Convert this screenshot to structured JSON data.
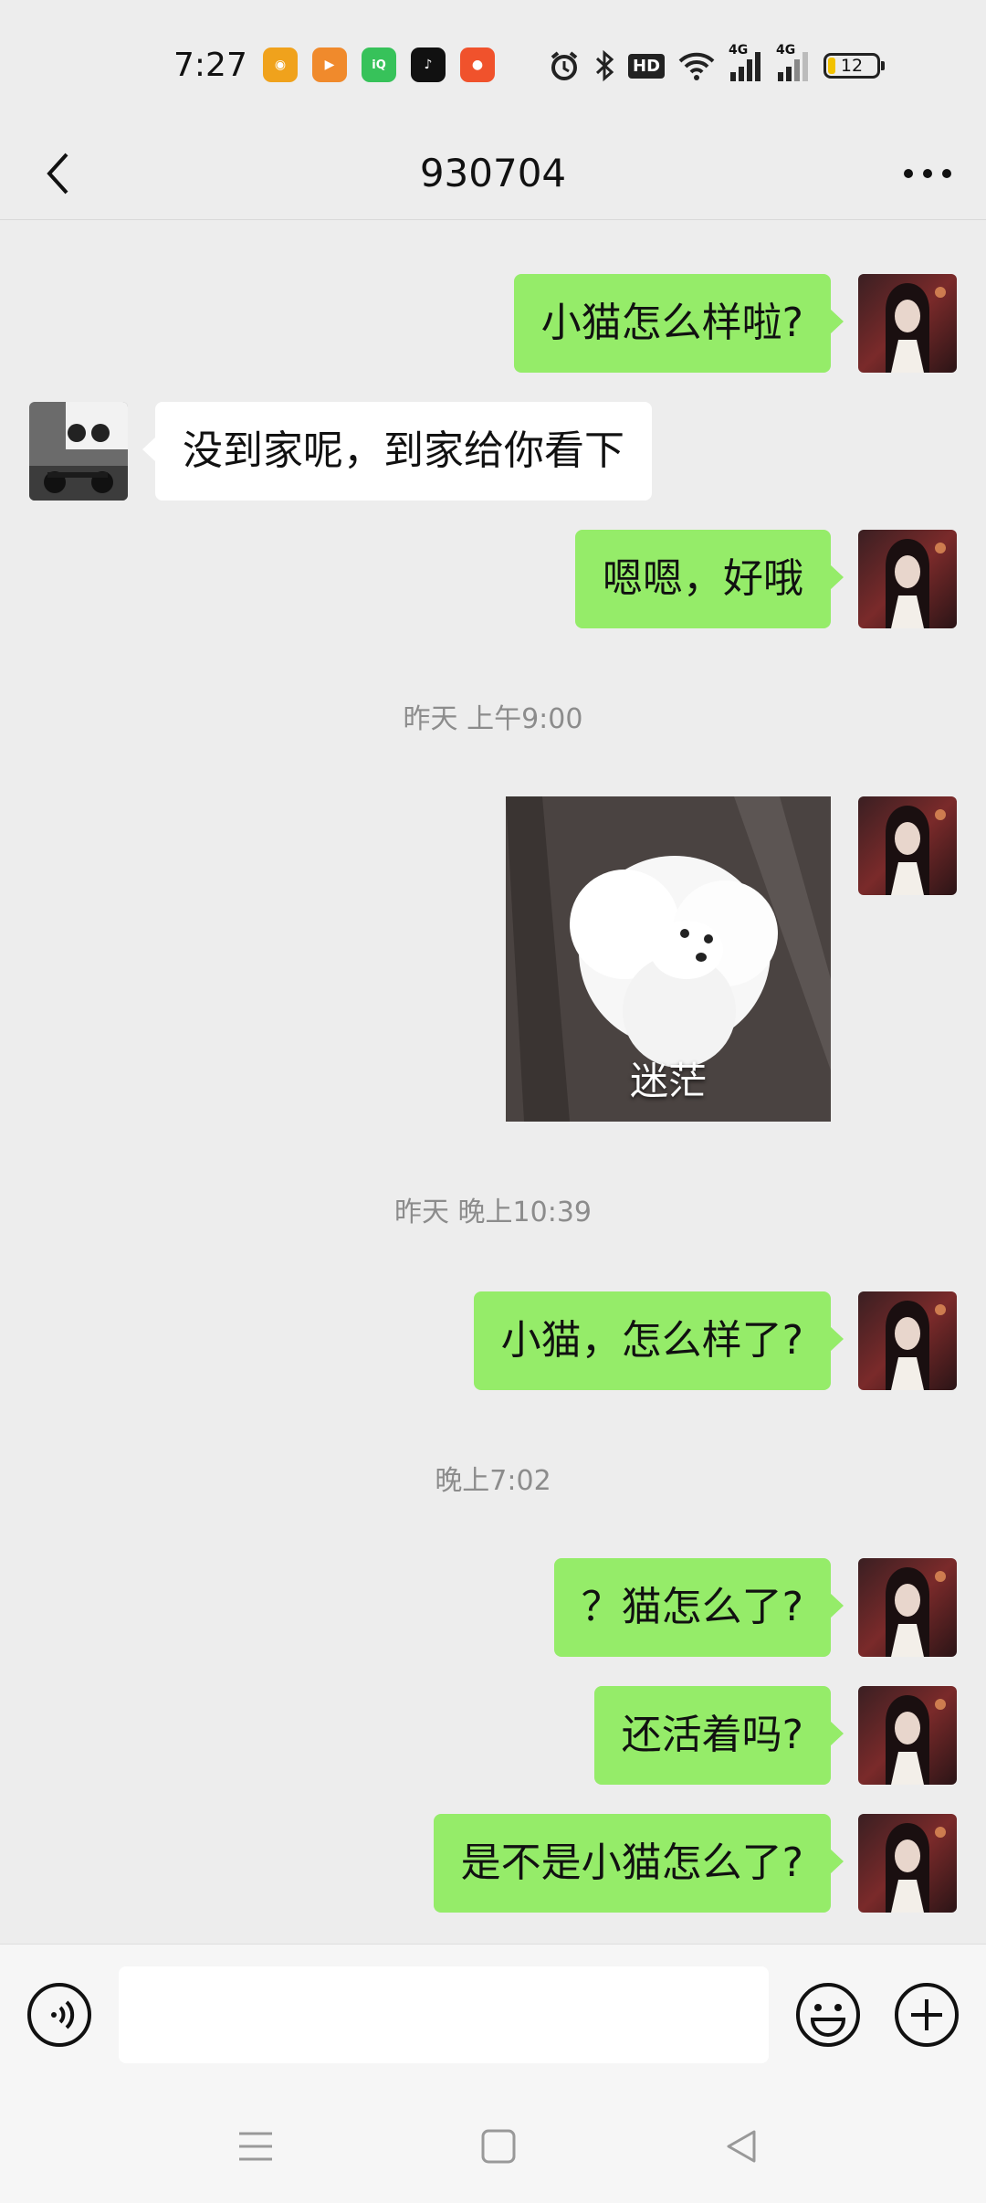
{
  "status_bar": {
    "time": "7:27",
    "apps": [
      {
        "icon": "weibo-icon",
        "color": "#f0a21c",
        "glyph": "◉"
      },
      {
        "icon": "kuaishou-icon",
        "color": "#f08a2c",
        "glyph": "▶"
      },
      {
        "icon": "iqiyi-icon",
        "color": "#37c25a",
        "glyph": "iQ"
      },
      {
        "icon": "douyin-icon",
        "color": "#111111",
        "glyph": "♪"
      },
      {
        "icon": "taobao-icon",
        "color": "#f0522c",
        "glyph": "●"
      }
    ],
    "signal_label_1": "4G",
    "signal_label_2": "4G",
    "hd_label": "HD",
    "battery_level": "12"
  },
  "header": {
    "title": "930704"
  },
  "messages": [
    {
      "side": "right",
      "text": "小猫怎么样啦?"
    },
    {
      "side": "left",
      "text": "没到家呢，到家给你看下"
    },
    {
      "side": "right",
      "text": "嗯嗯，好哦"
    },
    {
      "type": "timestamp",
      "text": "昨天 上午9:00"
    },
    {
      "side": "right",
      "type": "sticker",
      "caption": "迷茫"
    },
    {
      "type": "timestamp",
      "text": "昨天 晚上10:39"
    },
    {
      "side": "right",
      "text": "小猫，怎么样了?"
    },
    {
      "type": "timestamp",
      "text": "晚上7:02"
    },
    {
      "side": "right",
      "text": "？猫怎么了?"
    },
    {
      "side": "right",
      "text": "还活着吗?"
    },
    {
      "side": "right",
      "text": "是不是小猫怎么了?"
    }
  ],
  "input_bar": {
    "placeholder": ""
  },
  "colors": {
    "background": "#ededed",
    "outgoing_bubble": "#95ec69",
    "incoming_bubble": "#ffffff",
    "timestamp": "#8c8c8c"
  }
}
